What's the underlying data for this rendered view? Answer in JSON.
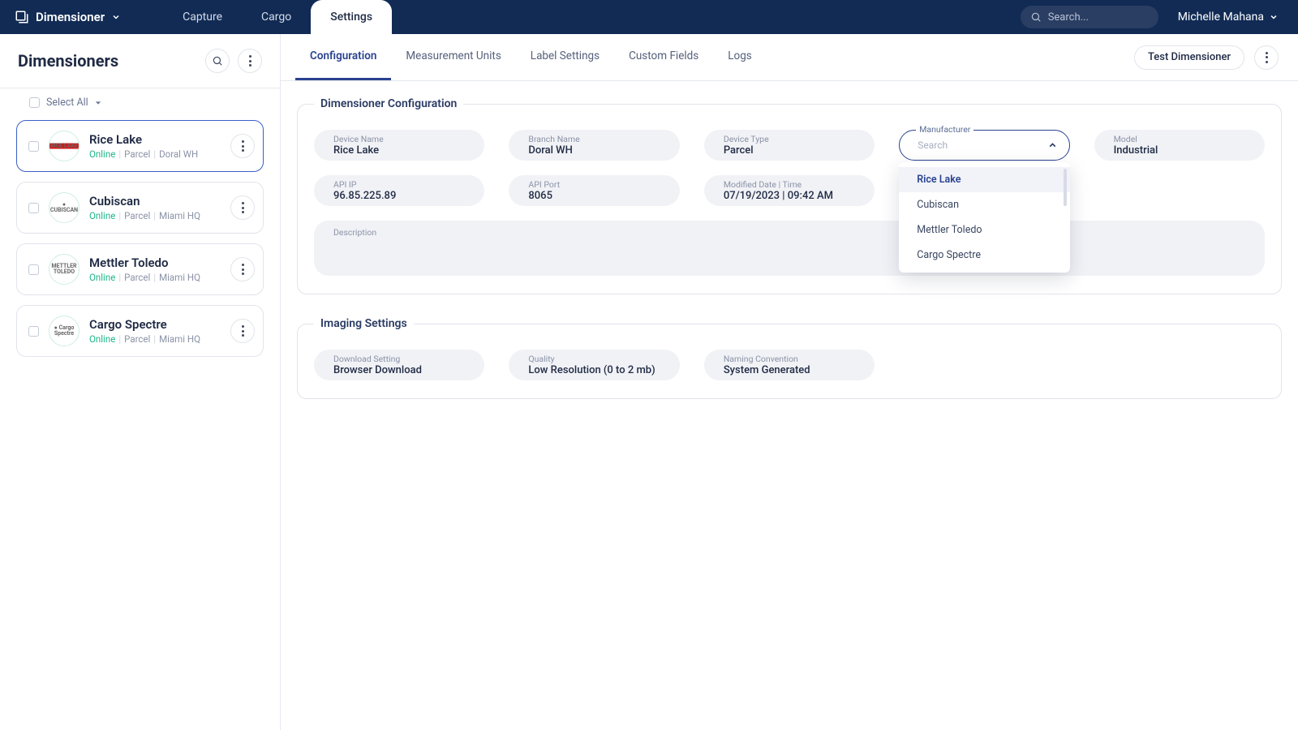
{
  "brand": "Dimensioner",
  "topnav": {
    "capture": "Capture",
    "cargo": "Cargo",
    "settings": "Settings"
  },
  "search": {
    "placeholder": "Search..."
  },
  "user": {
    "name": "Michelle Mahana"
  },
  "sidebar": {
    "title": "Dimensioners",
    "select_all": "Select All",
    "online_label": "Online",
    "items": [
      {
        "name": "Rice Lake",
        "type": "Parcel",
        "location": "Doral WH",
        "logo": "RICE LAKE"
      },
      {
        "name": "Cubiscan",
        "type": "Parcel",
        "location": "Miami HQ",
        "logo": "● CUBISCAN"
      },
      {
        "name": "Mettler Toledo",
        "type": "Parcel",
        "location": "Miami HQ",
        "logo": "METTLER TOLEDO"
      },
      {
        "name": "Cargo Spectre",
        "type": "Parcel",
        "location": "Miami HQ",
        "logo": "● Cargo Spectre"
      }
    ]
  },
  "tabs": {
    "configuration": "Configuration",
    "units": "Measurement Units",
    "label": "Label Settings",
    "custom": "Custom Fields",
    "logs": "Logs"
  },
  "actions": {
    "test": "Test Dimensioner"
  },
  "config_panel": {
    "legend": "Dimensioner Configuration",
    "device_name": {
      "label": "Device Name",
      "value": "Rice Lake"
    },
    "branch_name": {
      "label": "Branch Name",
      "value": "Doral WH"
    },
    "device_type": {
      "label": "Device Type",
      "value": "Parcel"
    },
    "manufacturer": {
      "label": "Manufacturer",
      "placeholder": "Search",
      "options": [
        "Rice Lake",
        "Cubiscan",
        "Mettler Toledo",
        "Cargo Spectre"
      ]
    },
    "model": {
      "label": "Model",
      "value": "Industrial"
    },
    "api_ip": {
      "label": "API IP",
      "value": "96.85.225.89"
    },
    "api_port": {
      "label": "API Port",
      "value": "8065"
    },
    "modified": {
      "label": "Modified Date | Time",
      "value": "07/19/2023 | 09:42 AM"
    },
    "description": {
      "label": "Description",
      "value": ""
    }
  },
  "imaging_panel": {
    "legend": "Imaging Settings",
    "download": {
      "label": "Download Setting",
      "value": "Browser Download"
    },
    "quality": {
      "label": "Quality",
      "value": "Low Resolution (0 to 2 mb)"
    },
    "naming": {
      "label": "Naming Convention",
      "value": "System Generated"
    }
  }
}
